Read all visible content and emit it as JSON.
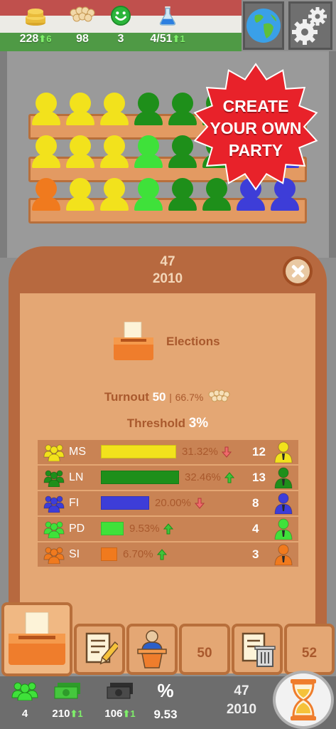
{
  "top_bar": {
    "money": {
      "icon": "coins-icon",
      "value": "228",
      "delta": "6"
    },
    "members": {
      "icon": "crowd-icon",
      "value": "98"
    },
    "happiness": {
      "icon": "smiley-icon",
      "value": "3"
    },
    "research": {
      "icon": "flask-icon",
      "value": "4/51",
      "delta": "1"
    },
    "world_button": {
      "icon": "globe-icon"
    },
    "settings_button": {
      "icon": "gears-icon"
    }
  },
  "promo_badge": {
    "text": "CREATE\nYOUR OWN\nPARTY",
    "color": "#e8222a"
  },
  "parliament": {
    "rows": [
      [
        "#f2e21c",
        "#f2e21c",
        "#f2e21c",
        "#1e8f1a",
        "#1e8f1a",
        "#1e8f1a",
        "#3d3dd8",
        "#3d3dd8"
      ],
      [
        "#f2e21c",
        "#f2e21c",
        "#f2e21c",
        "#3fe13a",
        "#1e8f1a",
        "#1e8f1a",
        "#3d3dd8",
        "#3d3dd8"
      ],
      [
        "#f07a1e",
        "#f2e21c",
        "#f2e21c",
        "#3fe13a",
        "#1e8f1a",
        "#1e8f1a",
        "#3d3dd8",
        "#3d3dd8"
      ]
    ]
  },
  "panel": {
    "day": "47",
    "year": "2010",
    "title": "Elections",
    "turnout_label": "Turnout",
    "turnout_value": "50",
    "turnout_sep": "|",
    "turnout_percent": "66.7%",
    "threshold_label": "Threshold",
    "threshold_value": "3",
    "threshold_unit": "%",
    "results": [
      {
        "party": "MS",
        "color": "#f2e21c",
        "percent": "31.32%",
        "trend": "down",
        "seats": "12",
        "bar": 0.3132
      },
      {
        "party": "LN",
        "color": "#1e8f1a",
        "percent": "32.46%",
        "trend": "up",
        "seats": "13",
        "bar": 0.3246
      },
      {
        "party": "FI",
        "color": "#3d3dd8",
        "percent": "20.00%",
        "trend": "down",
        "seats": "8",
        "bar": 0.2
      },
      {
        "party": "PD",
        "color": "#3fe13a",
        "percent": "9.53%",
        "trend": "up",
        "seats": "4",
        "bar": 0.0953
      },
      {
        "party": "SI",
        "color": "#f07a1e",
        "percent": "6.70%",
        "trend": "up",
        "seats": "3",
        "bar": 0.067
      }
    ]
  },
  "actions": [
    {
      "id": "ballot-box",
      "icon": "ballot-box-icon",
      "label": ""
    },
    {
      "id": "write-law",
      "icon": "document-pencil-icon",
      "label": ""
    },
    {
      "id": "speech",
      "icon": "speaker-podium-icon",
      "label": ""
    },
    {
      "id": "counter-a",
      "label": "50"
    },
    {
      "id": "delete-law",
      "icon": "document-trash-icon",
      "label": ""
    },
    {
      "id": "counter-b",
      "label": "52"
    }
  ],
  "bottom_bar": {
    "members": {
      "icon": "people-icon",
      "value": "4"
    },
    "income": {
      "icon": "cash-icon",
      "value": "210",
      "delta": "1"
    },
    "expenses": {
      "icon": "dark-cash-icon",
      "value": "106",
      "delta": "1"
    },
    "vote_share": {
      "icon": "percent-icon",
      "symbol": "%",
      "value": "9.53"
    },
    "day": "47",
    "year": "2010",
    "next_turn": {
      "icon": "hourglass-icon"
    }
  }
}
